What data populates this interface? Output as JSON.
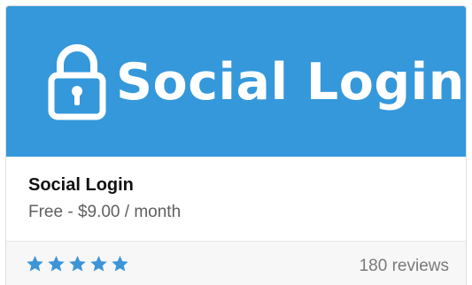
{
  "banner": {
    "title": "Social Login",
    "icon": "lock-icon",
    "background_color": "#3498db"
  },
  "app": {
    "name": "Social Login",
    "price": "Free - $9.00 / month"
  },
  "rating": {
    "stars": 5,
    "max_stars": 5,
    "star_icon": "star-icon",
    "star_color": "#3d95d8",
    "reviews_label": "180 reviews"
  }
}
